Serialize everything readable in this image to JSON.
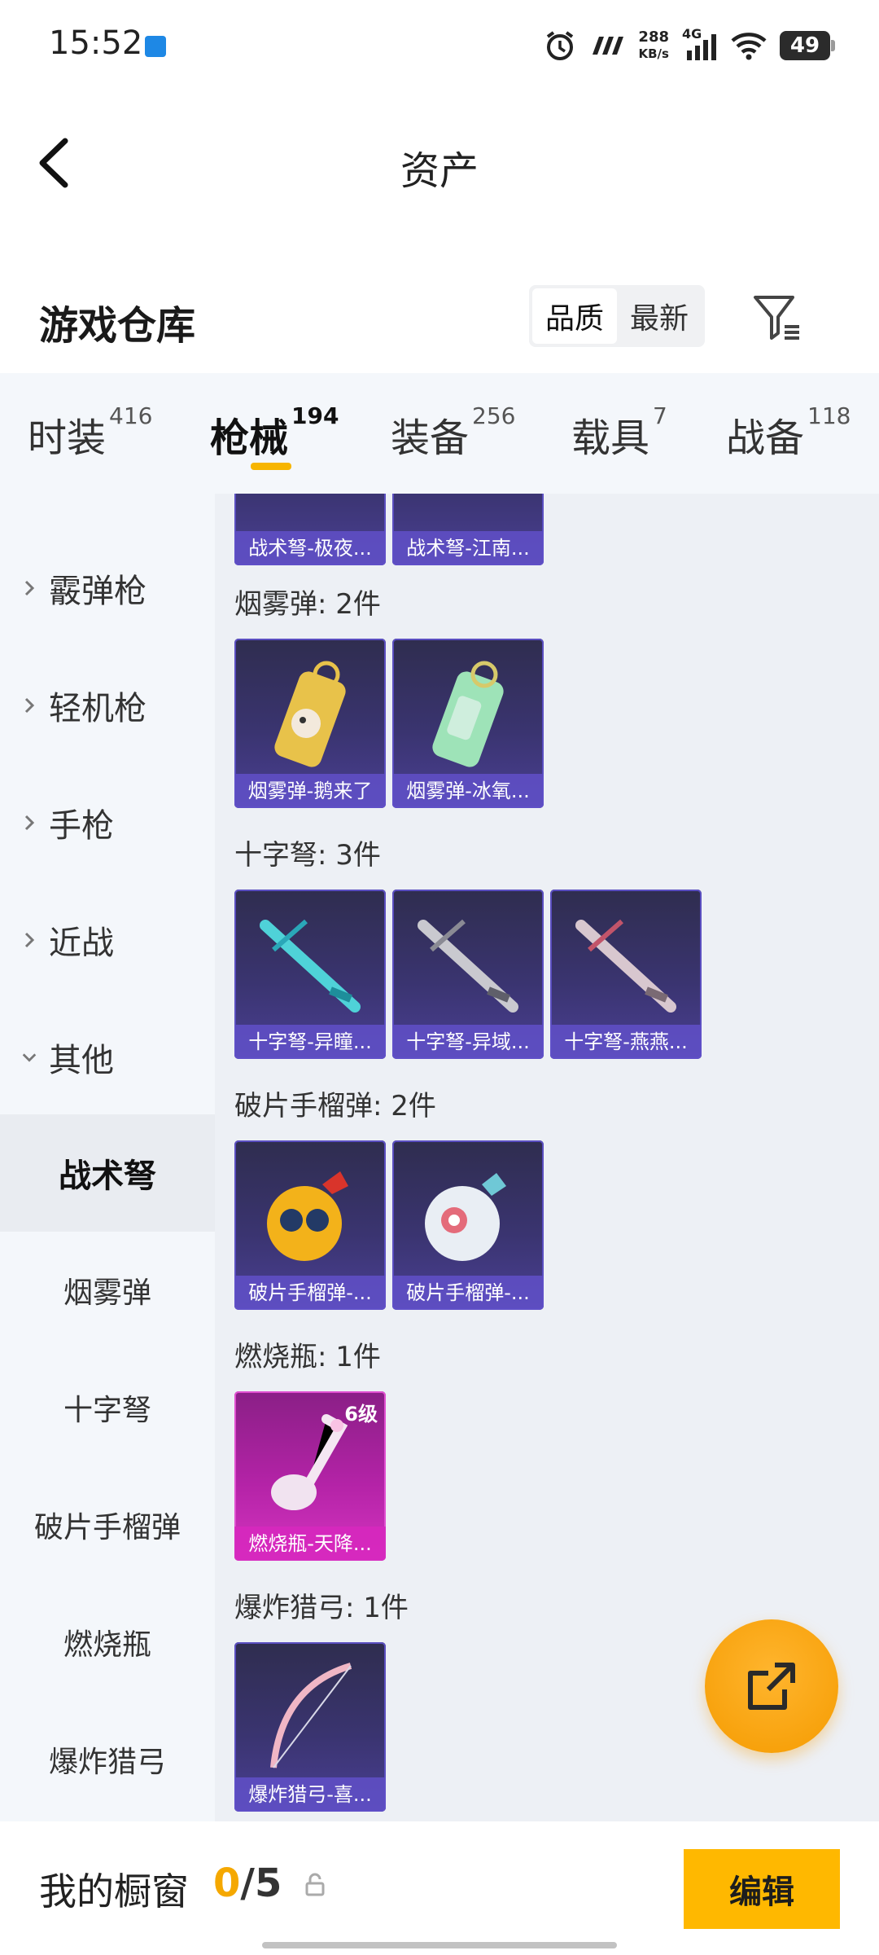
{
  "status_bar": {
    "time": "15:52",
    "net_speed_value": "288",
    "net_speed_unit": "KB/s",
    "network": "4G",
    "battery": "49"
  },
  "header": {
    "title": "资产"
  },
  "warehouse": {
    "title": "游戏仓库",
    "sort_options": [
      "品质",
      "最新"
    ],
    "active_sort": "品质"
  },
  "tabs": [
    {
      "label": "时装",
      "count": "416"
    },
    {
      "label": "枪械",
      "count": "194"
    },
    {
      "label": "装备",
      "count": "256"
    },
    {
      "label": "载具",
      "count": "7"
    },
    {
      "label": "战备",
      "count": "118"
    }
  ],
  "active_tab": "枪械",
  "sidebar": {
    "categories": [
      "霰弹枪",
      "轻机枪",
      "手枪",
      "近战",
      "其他"
    ],
    "expanded": "其他",
    "subcategories": [
      "战术弩",
      "烟雾弹",
      "十字弩",
      "破片手榴弹",
      "燃烧瓶",
      "爆炸猎弓"
    ],
    "active_sub": "战术弩"
  },
  "sections": [
    {
      "title": "",
      "items": [
        {
          "name": "战术弩-极夜..."
        },
        {
          "name": "战术弩-江南..."
        }
      ]
    },
    {
      "title": "烟雾弹: 2件",
      "items": [
        {
          "name": "烟雾弹-鹅来了"
        },
        {
          "name": "烟雾弹-冰氧..."
        }
      ]
    },
    {
      "title": "十字弩: 3件",
      "items": [
        {
          "name": "十字弩-异瞳..."
        },
        {
          "name": "十字弩-异域..."
        },
        {
          "name": "十字弩-燕燕..."
        }
      ]
    },
    {
      "title": "破片手榴弹: 2件",
      "items": [
        {
          "name": "破片手榴弹-..."
        },
        {
          "name": "破片手榴弹-..."
        }
      ]
    },
    {
      "title": "燃烧瓶: 1件",
      "items": [
        {
          "name": "燃烧瓶-天降...",
          "level": "6级"
        }
      ]
    },
    {
      "title": "爆炸猎弓: 1件",
      "items": [
        {
          "name": "爆炸猎弓-喜..."
        }
      ]
    }
  ],
  "bottom_bar": {
    "label": "我的橱窗",
    "count_current": "0",
    "count_total": "/5",
    "edit_label": "编辑"
  },
  "colors": {
    "accent": "#f7b500",
    "card_purple": "#3a3470",
    "card_pink": "#b423a7"
  },
  "icons": {
    "back": "chevron-left-icon",
    "filter": "filter-icon",
    "share": "share-external-icon",
    "lock": "lock-icon"
  }
}
